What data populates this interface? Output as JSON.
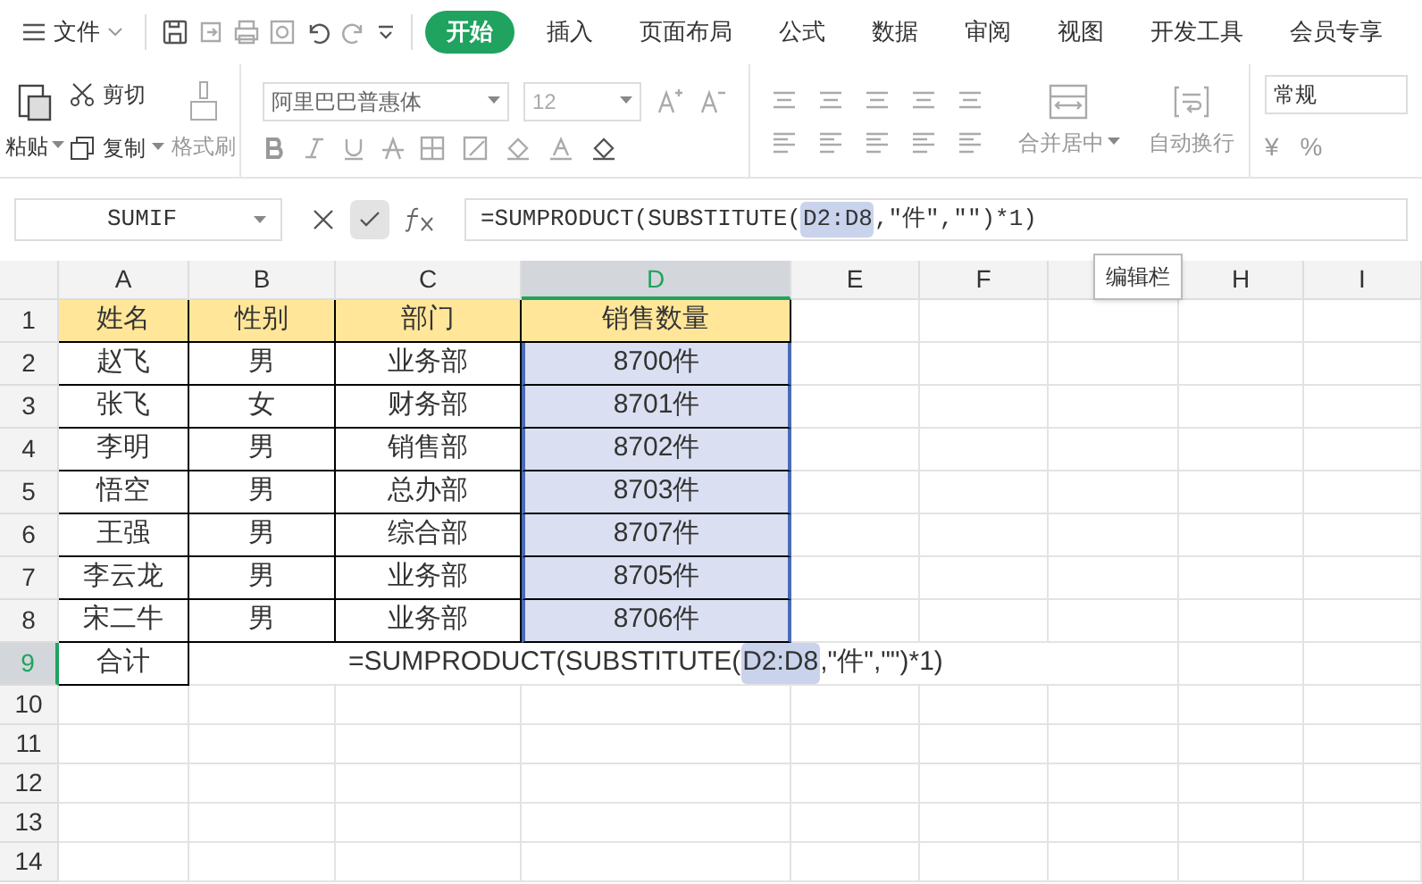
{
  "file_menu": {
    "label": "文件"
  },
  "tabs": [
    {
      "label": "开始",
      "selected": true
    },
    {
      "label": "插入",
      "selected": false
    },
    {
      "label": "页面布局",
      "selected": false
    },
    {
      "label": "公式",
      "selected": false
    },
    {
      "label": "数据",
      "selected": false
    },
    {
      "label": "审阅",
      "selected": false
    },
    {
      "label": "视图",
      "selected": false
    },
    {
      "label": "开发工具",
      "selected": false
    },
    {
      "label": "会员专享",
      "selected": false
    }
  ],
  "ribbon": {
    "paste": "粘贴",
    "cut": "剪切",
    "copy": "复制",
    "format_painter": {
      "label": "格式刷",
      "disabled": true
    },
    "font_name": "阿里巴巴普惠体",
    "font_size": "12",
    "merge": {
      "label": "合并居中",
      "disabled": true
    },
    "wrap": {
      "label": "自动换行",
      "disabled": true
    },
    "number_format": "常规",
    "currency_symbol": "¥",
    "percent_symbol": "%"
  },
  "name_box": "SUMIF",
  "formula_bar": {
    "prefix": "=SUMPRODUCT(SUBSTITUTE(",
    "reference": "D2:D8",
    "suffix": ",\"件\",\"\")*1)"
  },
  "tooltip": "编辑栏",
  "columns": [
    {
      "label": "A",
      "selected": false
    },
    {
      "label": "B",
      "selected": false
    },
    {
      "label": "C",
      "selected": false
    },
    {
      "label": "D",
      "selected": true
    },
    {
      "label": "E",
      "selected": false
    },
    {
      "label": "F",
      "selected": false
    },
    {
      "selected": false
    },
    {
      "label": "H",
      "selected": false
    },
    {
      "label": "I",
      "selected": false
    }
  ],
  "rows": [
    {
      "number": "1",
      "selected": false,
      "header": true,
      "in_selection": false,
      "cells": [
        "姓名",
        "性别",
        "部门",
        "销售数量"
      ]
    },
    {
      "number": "2",
      "selected": false,
      "header": false,
      "in_selection": true,
      "cells": [
        "赵飞",
        "男",
        "业务部",
        "8700件"
      ]
    },
    {
      "number": "3",
      "selected": false,
      "header": false,
      "in_selection": true,
      "cells": [
        "张飞",
        "女",
        "财务部",
        "8701件"
      ]
    },
    {
      "number": "4",
      "selected": false,
      "header": false,
      "in_selection": true,
      "cells": [
        "李明",
        "男",
        "销售部",
        "8702件"
      ]
    },
    {
      "number": "5",
      "selected": false,
      "header": false,
      "in_selection": true,
      "cells": [
        "悟空",
        "男",
        "总办部",
        "8703件"
      ]
    },
    {
      "number": "6",
      "selected": false,
      "header": false,
      "in_selection": true,
      "cells": [
        "王强",
        "男",
        "综合部",
        "8707件"
      ]
    },
    {
      "number": "7",
      "selected": false,
      "header": false,
      "in_selection": true,
      "cells": [
        "李云龙",
        "男",
        "业务部",
        "8705件"
      ]
    },
    {
      "number": "8",
      "selected": false,
      "header": false,
      "in_selection": true,
      "cells": [
        "宋二牛",
        "男",
        "业务部",
        "8706件"
      ]
    },
    {
      "number": "9",
      "selected": true,
      "cells": [
        "合计"
      ],
      "formula": {
        "prefix": "=SUMPRODUCT(SUBSTITUTE(",
        "reference": "D2:D8",
        "suffix": ",\"件\",\"\")*1)"
      }
    },
    {
      "number": "10",
      "selected": false,
      "cells": []
    },
    {
      "number": "11",
      "selected": false,
      "cells": []
    },
    {
      "number": "12",
      "selected": false,
      "cells": []
    },
    {
      "number": "13",
      "selected": false,
      "cells": []
    },
    {
      "number": "14",
      "selected": false,
      "cells": []
    }
  ]
}
